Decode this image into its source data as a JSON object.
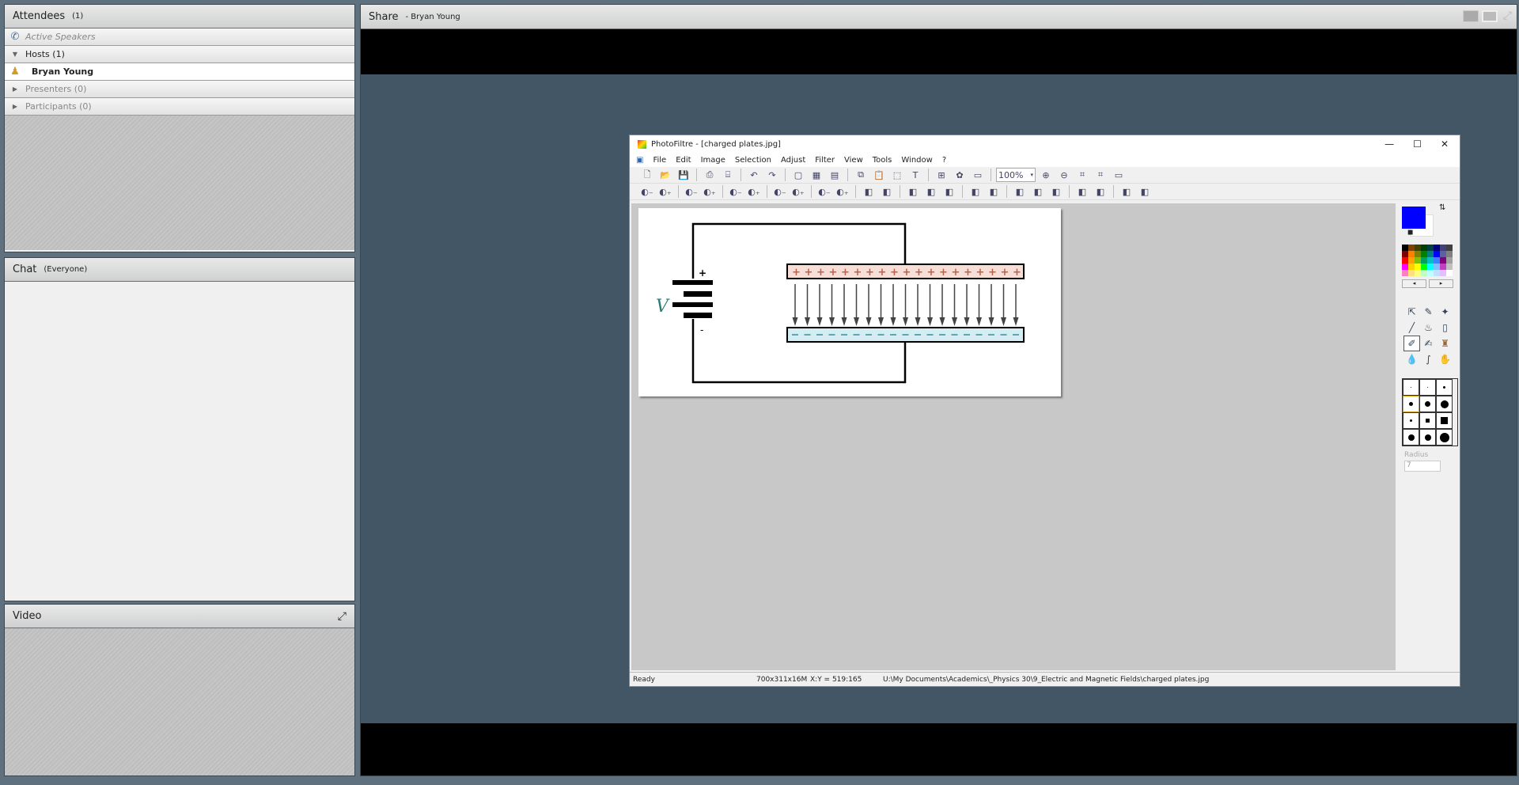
{
  "attendees": {
    "title": "Attendees",
    "count": "(1)",
    "active_speakers": "Active Speakers",
    "hosts": "Hosts (1)",
    "host_name": "Bryan Young",
    "presenters": "Presenters (0)",
    "participants": "Participants (0)"
  },
  "chat": {
    "title": "Chat",
    "scope": "(Everyone)"
  },
  "video": {
    "title": "Video"
  },
  "share": {
    "title": "Share",
    "presenter": "- Bryan Young"
  },
  "photofiltre": {
    "title": "PhotoFiltre - [charged plates.jpg]",
    "menu": [
      "File",
      "Edit",
      "Image",
      "Selection",
      "Adjust",
      "Filter",
      "View",
      "Tools",
      "Window",
      "?"
    ],
    "zoom": "100%",
    "toolbar1": [
      "new",
      "open",
      "save",
      "|",
      "print",
      "scan",
      "|",
      "undo",
      "redo",
      "|",
      "mask",
      "color-palette",
      "filter",
      "|",
      "copy",
      "paste",
      "crop",
      "text",
      "|",
      "explorer",
      "plugin",
      "window",
      "|"
    ],
    "toolbar1_after": [
      "zoom-in",
      "zoom-out",
      "fit",
      "actual-size",
      "slideshow"
    ],
    "toolbar2": [
      "levels-minus",
      "levels-plus",
      "|",
      "brightness-minus",
      "brightness-plus",
      "|",
      "contrast-minus",
      "contrast-plus",
      "|",
      "saturation-minus",
      "saturation-plus",
      "|",
      "gamma-minus",
      "gamma-plus",
      "|",
      "negative",
      "sepia",
      "|",
      "flip",
      "blur",
      "sharpen",
      "|",
      "soften",
      "emboss",
      "|",
      "gradient",
      "gradient2",
      "watercolor",
      "|",
      "split-h",
      "split-v",
      "|",
      "duplicate",
      "frame"
    ],
    "primary_color": "#0000ff",
    "secondary_color": "#ffffff",
    "palette": [
      "#000000",
      "#804000",
      "#404000",
      "#004000",
      "#004040",
      "#000080",
      "#404080",
      "#404040",
      "#800000",
      "#ff8000",
      "#808000",
      "#008000",
      "#008080",
      "#0000ff",
      "#6060a0",
      "#808080",
      "#ff0000",
      "#ffa000",
      "#80c000",
      "#00a060",
      "#00c0c0",
      "#4080ff",
      "#800080",
      "#a0a0a0",
      "#ff00ff",
      "#ffd000",
      "#ffff00",
      "#00ff00",
      "#00ffff",
      "#80c0ff",
      "#c040c0",
      "#c0c0c0",
      "#ff80c0",
      "#ffe080",
      "#ffff80",
      "#c0ffc0",
      "#c0ffff",
      "#c0e0ff",
      "#e0c0ff",
      "#ffffff"
    ],
    "radius_label": "Radius",
    "radius_value": "7",
    "status": {
      "state": "Ready",
      "size": "700x311x16M",
      "coords": "X:Y = 519:165",
      "path": "U:\\My Documents\\Academics\\_Physics 30\\9_Electric and Magnetic Fields\\charged plates.jpg"
    },
    "image": {
      "voltage_label": "V",
      "plus": "+",
      "minus": "-",
      "plate_charges": 19,
      "plate_top_color": "#f7ded6",
      "plate_bottom_color": "#d4ecf2",
      "charge_plus_color": "#c0604a",
      "charge_minus_color": "#5aa8b4"
    }
  }
}
